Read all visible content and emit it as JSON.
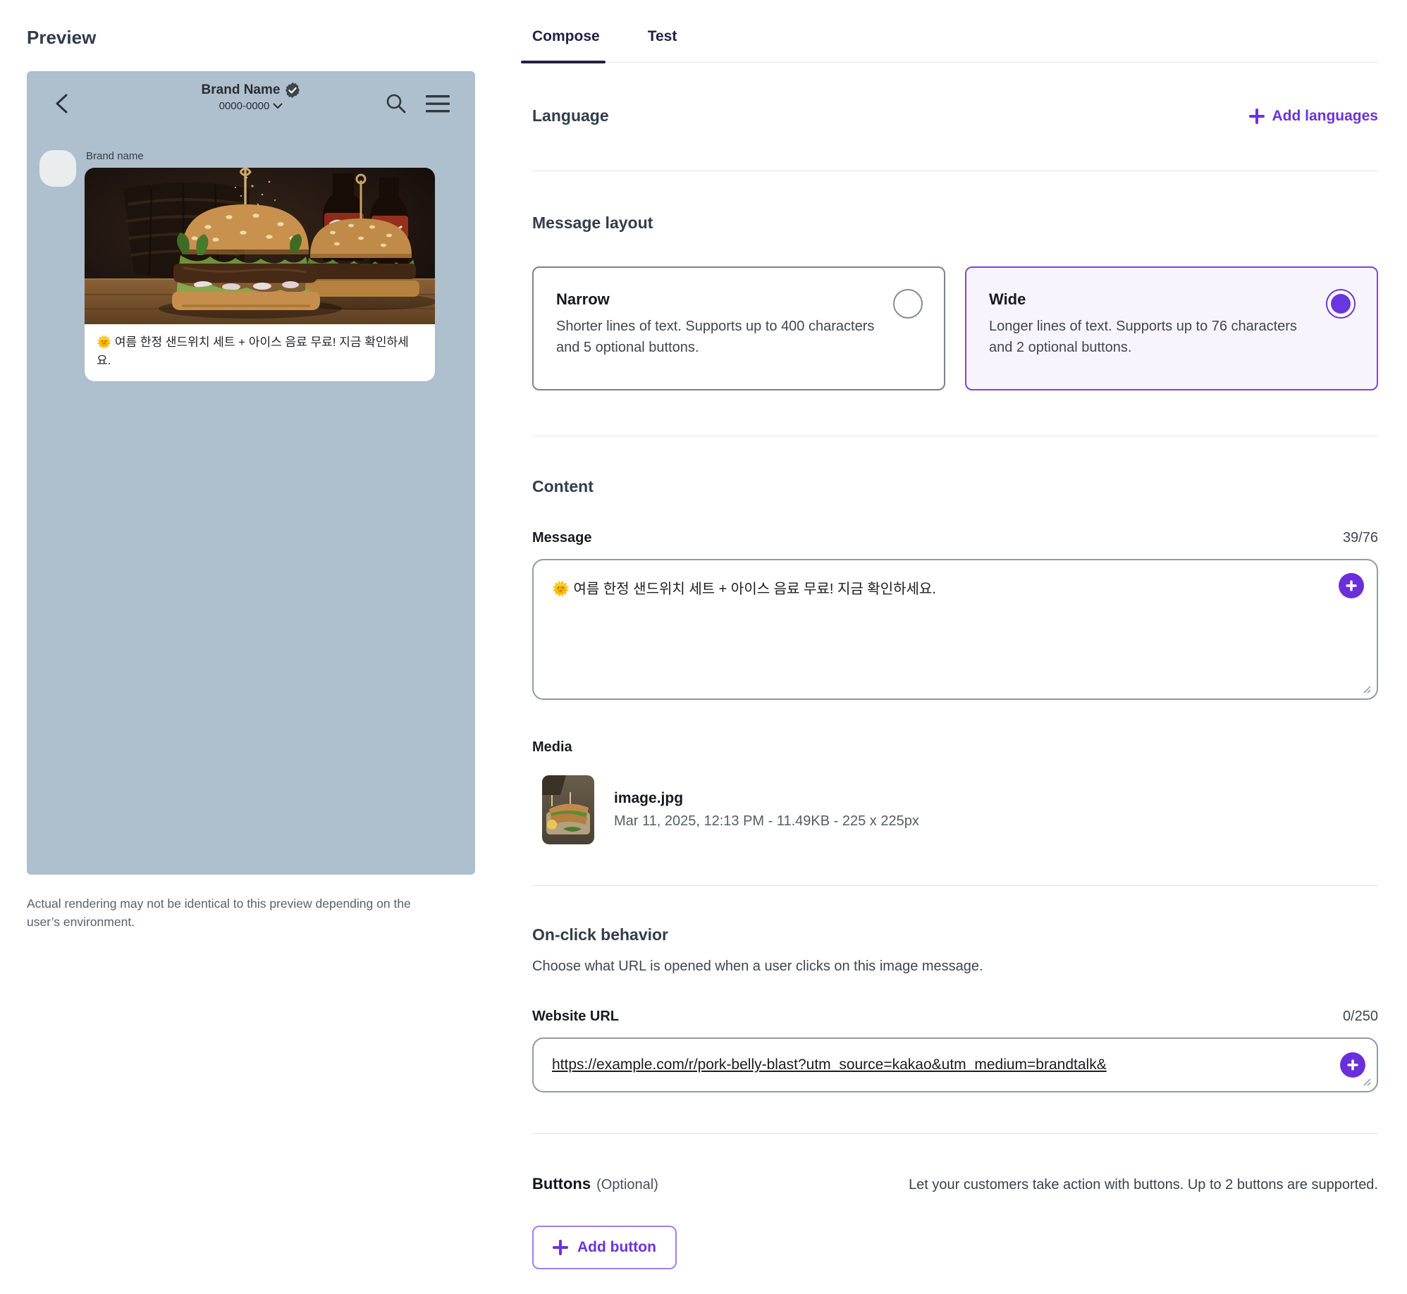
{
  "colors": {
    "accent": "#6b33da",
    "preview_bg": "#aec0ce",
    "selected_card_bg": "#f7f4fd"
  },
  "preview": {
    "title": "Preview",
    "chat": {
      "brand_name": "Brand Name",
      "phone_number": "0000-0000",
      "sender_name": "Brand name"
    },
    "disclaimer": "Actual rendering may not be identical to this preview depending on the user’s environment."
  },
  "tabs": {
    "compose": "Compose",
    "test": "Test"
  },
  "language": {
    "heading": "Language",
    "add_link": "Add languages"
  },
  "message_layout": {
    "heading": "Message layout",
    "options": [
      {
        "title": "Narrow",
        "description": "Shorter lines of text. Supports up to 400 characters and 5 optional buttons.",
        "selected": false
      },
      {
        "title": "Wide",
        "description": "Longer lines of text. Supports up to 76 characters and 2 optional buttons.",
        "selected": true
      }
    ]
  },
  "content": {
    "heading": "Content",
    "message_label": "Message",
    "message_counter": "39/76",
    "message_value": "🌞 여름 한정 샌드위치 세트 + 아이스 음료 무료! 지금 확인하세요.",
    "media_label": "Media",
    "media_file": {
      "name": "image.jpg",
      "meta": "Mar 11, 2025, 12:13 PM - 11.49KB - 225 x 225px"
    }
  },
  "on_click": {
    "heading": "On-click behavior",
    "description": "Choose what URL is opened when a user clicks on this image message.",
    "url_label": "Website URL",
    "url_counter": "0/250",
    "url_value": "https://example.com/r/pork-belly-blast?utm_source=kakao&utm_medium=brandtalk&"
  },
  "buttons_section": {
    "heading": "Buttons",
    "optional": "(Optional)",
    "description": "Let your customers take action with buttons. Up to 2 buttons are supported.",
    "add_button": "Add button"
  }
}
